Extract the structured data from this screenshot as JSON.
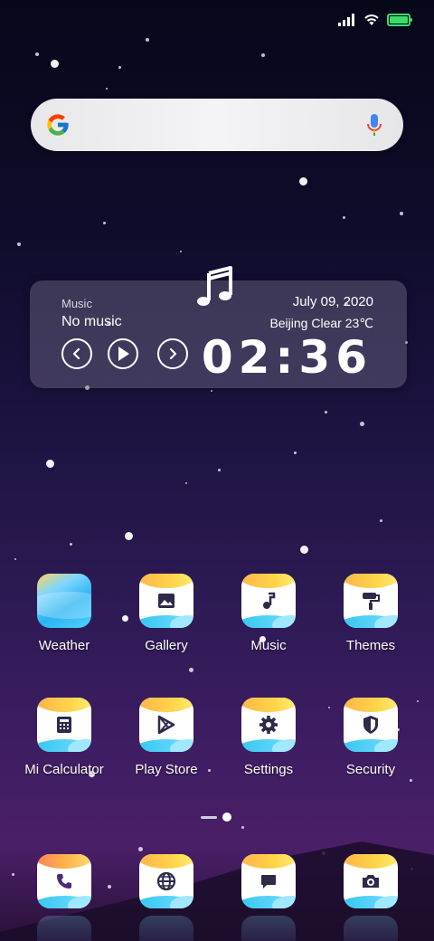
{
  "status_bar": {
    "signal_icon": "cellular-signal-icon",
    "wifi_icon": "wifi-icon",
    "battery_icon": "battery-icon",
    "battery_level": 1.0,
    "battery_color": "#3ddc6a"
  },
  "search": {
    "logo_icon": "google-g-icon",
    "mic_icon": "microphone-icon"
  },
  "widget": {
    "music_label": "Music",
    "music_status": "No music",
    "date": "July  09, 2020",
    "weather": "Beijing  Clear  23℃",
    "time": "02:36",
    "controls": [
      "previous-icon",
      "play-icon",
      "next-icon"
    ]
  },
  "apps": {
    "row1": [
      {
        "label": "Weather",
        "icon": "weather-icon"
      },
      {
        "label": "Gallery",
        "icon": "gallery-icon"
      },
      {
        "label": "Music",
        "icon": "music-icon"
      },
      {
        "label": "Themes",
        "icon": "themes-icon"
      }
    ],
    "row2": [
      {
        "label": "Mi Calculator",
        "icon": "calculator-icon"
      },
      {
        "label": "Play Store",
        "icon": "play-store-icon"
      },
      {
        "label": "Settings",
        "icon": "settings-icon"
      },
      {
        "label": "Security",
        "icon": "security-icon"
      }
    ]
  },
  "dock": [
    {
      "icon": "phone-icon"
    },
    {
      "icon": "browser-icon"
    },
    {
      "icon": "messages-icon"
    },
    {
      "icon": "camera-icon"
    }
  ],
  "page_indicator": {
    "pages": 2,
    "current": 2
  },
  "colors": {
    "icon_glyph": "#2d2a4a",
    "widget_bg": "rgba(120,115,140,0.42)"
  }
}
